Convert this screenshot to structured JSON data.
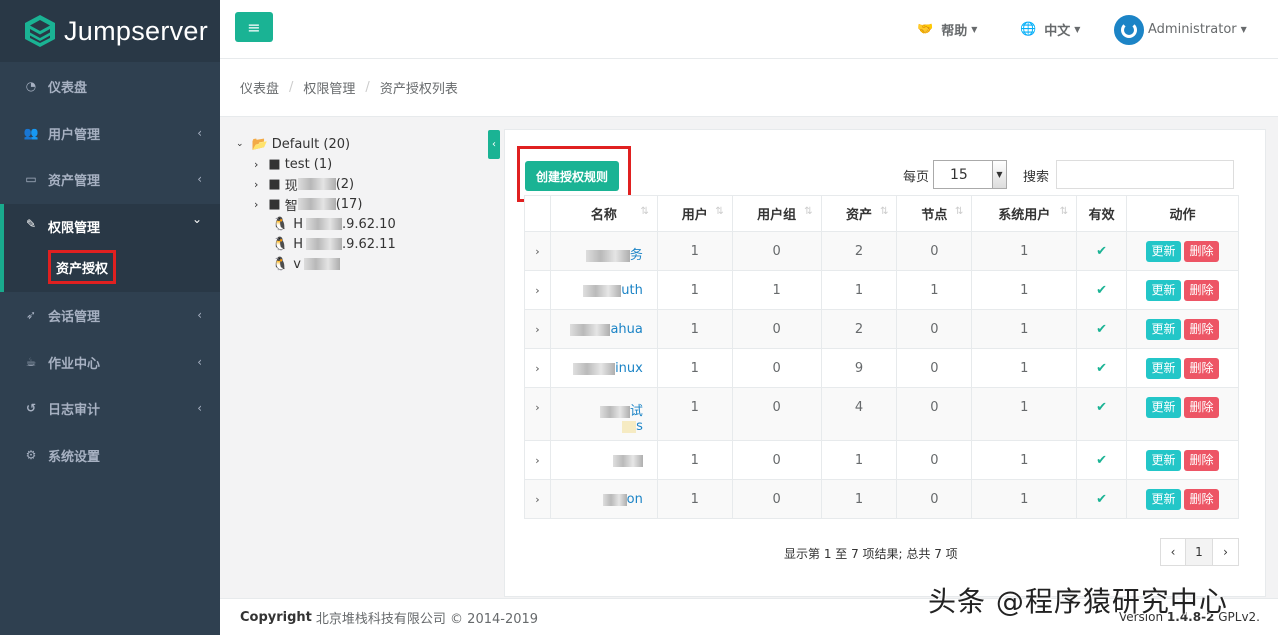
{
  "brand": {
    "name": "Jumpserver"
  },
  "sidebar": {
    "items": [
      {
        "label": "仪表盘",
        "icon": "dashboard-icon",
        "arrow": ""
      },
      {
        "label": "用户管理",
        "icon": "users-icon",
        "arrow": "‹"
      },
      {
        "label": "资产管理",
        "icon": "inbox-icon",
        "arrow": "‹"
      },
      {
        "label": "权限管理",
        "icon": "edit-icon",
        "arrow": "⌄"
      },
      {
        "label": "会话管理",
        "icon": "rocket-icon",
        "arrow": "‹"
      },
      {
        "label": "作业中心",
        "icon": "coffee-icon",
        "arrow": "‹"
      },
      {
        "label": "日志审计",
        "icon": "history-icon",
        "arrow": "‹"
      },
      {
        "label": "系统设置",
        "icon": "gears-icon",
        "arrow": ""
      }
    ],
    "sub_item": "资产授权"
  },
  "topbar": {
    "menu_icon": "≡",
    "help": "帮助",
    "language": "中文",
    "user": "Administrator"
  },
  "breadcrumb": [
    "仪表盘",
    "权限管理",
    "资产授权列表"
  ],
  "tree": {
    "root": "Default (20)",
    "nodes": [
      {
        "pre": "",
        "label": "test (1)",
        "type": "folder"
      },
      {
        "pre": "现",
        "label": "(2)",
        "type": "folder"
      },
      {
        "pre": "智",
        "label": " (17)",
        "type": "folder"
      },
      {
        "pre": "H",
        "label": ".9.62.10",
        "type": "linux"
      },
      {
        "pre": "H",
        "label": ".9.62.11",
        "type": "linux"
      },
      {
        "pre": "v",
        "label": "",
        "type": "linux"
      }
    ]
  },
  "toolbar": {
    "create_label": "创建授权规则",
    "per_page_label": "每页",
    "per_page_value": "15",
    "search_label": "搜索"
  },
  "table": {
    "headers": [
      "名称",
      "用户",
      "用户组",
      "资产",
      "节点",
      "系统用户",
      "有效",
      "动作"
    ],
    "update_label": "更新",
    "delete_label": "删除",
    "rows": [
      {
        "name": "务",
        "users": "1",
        "groups": "0",
        "assets": "2",
        "nodes": "0",
        "system_users": "1"
      },
      {
        "name": "uth",
        "users": "1",
        "groups": "1",
        "assets": "1",
        "nodes": "1",
        "system_users": "1"
      },
      {
        "name": "ahua",
        "users": "1",
        "groups": "0",
        "assets": "2",
        "nodes": "0",
        "system_users": "1"
      },
      {
        "name": "inux",
        "users": "1",
        "groups": "0",
        "assets": "9",
        "nodes": "0",
        "system_users": "1"
      },
      {
        "name": "试",
        "name2": "s",
        "users": "1",
        "groups": "0",
        "assets": "4",
        "nodes": "0",
        "system_users": "1"
      },
      {
        "name": "",
        "users": "1",
        "groups": "0",
        "assets": "1",
        "nodes": "0",
        "system_users": "1"
      },
      {
        "name": "on",
        "users": "1",
        "groups": "0",
        "assets": "1",
        "nodes": "0",
        "system_users": "1"
      }
    ]
  },
  "pagination": {
    "summary": "显示第 1 至 7 项结果; 总共 7 项",
    "prev": "‹",
    "page": "1",
    "next": "›"
  },
  "footer": {
    "copyright_label": "Copyright",
    "copyright_text": "北京堆栈科技有限公司 © 2014-2019",
    "version_prefix": "Version ",
    "version": "1.4.8-2",
    "license": " GPLv2."
  },
  "watermark": "头条 @程序猿研究中心",
  "colors": {
    "sidebar": "#2f4050",
    "primary": "#1ab394",
    "info": "#23c6c8",
    "danger": "#ed5565",
    "highlight": "#e02020"
  }
}
